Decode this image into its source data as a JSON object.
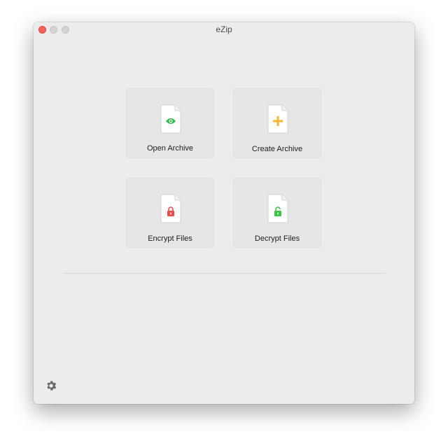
{
  "window": {
    "title": "eZip"
  },
  "actions": [
    {
      "label": "Open Archive",
      "icon": "eye-icon",
      "color": "#2eb84b"
    },
    {
      "label": "Create Archive",
      "icon": "plus-icon",
      "color": "#f5b731"
    },
    {
      "label": "Encrypt Files",
      "icon": "lock-icon",
      "color": "#ee4c46"
    },
    {
      "label": "Decrypt Files",
      "icon": "unlock-icon",
      "color": "#3cc34a"
    }
  ],
  "footer": {
    "settings_icon": "gear-icon"
  }
}
